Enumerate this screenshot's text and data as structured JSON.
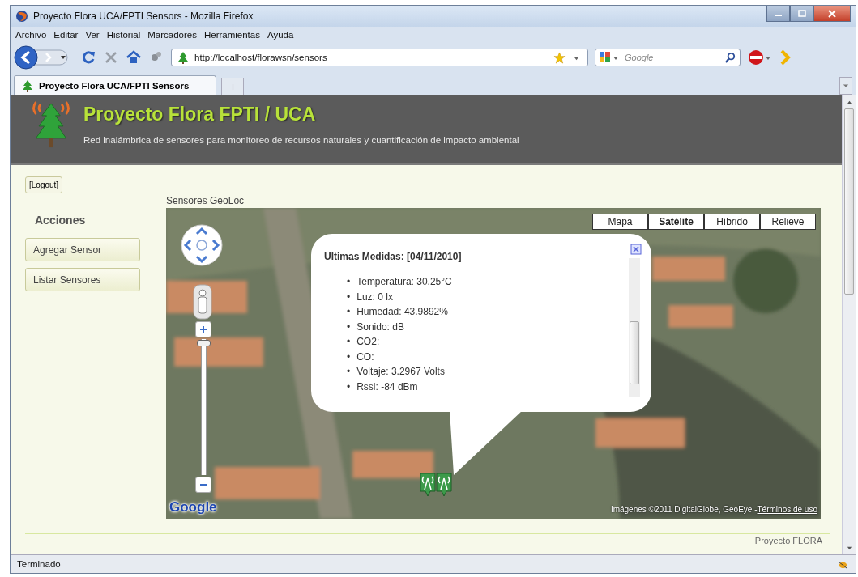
{
  "window": {
    "title": "Proyecto Flora UCA/FPTI Sensors - Mozilla Firefox"
  },
  "menu": [
    "Archivo",
    "Editar",
    "Ver",
    "Historial",
    "Marcadores",
    "Herramientas",
    "Ayuda"
  ],
  "toolbar": {
    "url": "http://localhost/florawsn/sensors",
    "search_placeholder": "Google"
  },
  "tabs": [
    {
      "label": "Proyecto Flora UCA/FPTI Sensors",
      "selected": true
    }
  ],
  "header": {
    "title": "Proyecto Flora FPTI / UCA",
    "subtitle": "Red inalámbrica de sensores para monitoreo de recursos naturales y cuantificación de impacto ambiental"
  },
  "sidebar": {
    "logout": "[Logout]",
    "heading": "Acciones",
    "buttons": [
      "Agregar Sensor",
      "Listar Sensores"
    ]
  },
  "map": {
    "label": "Sensores GeoLoc",
    "map_types": [
      {
        "label": "Mapa",
        "selected": false
      },
      {
        "label": "Satélite",
        "selected": true
      },
      {
        "label": "Híbrido",
        "selected": false
      },
      {
        "label": "Relieve",
        "selected": false
      }
    ],
    "zoom": {
      "level": 0.98
    },
    "info_window": {
      "title": "Ultimas Medidas: [04/11/2010]",
      "bullet": "•",
      "items": [
        "Temperatura: 30.25°C",
        "Luz: 0 lx",
        "Humedad: 43.9892%",
        "Sonido: dB",
        "CO2:",
        "CO:",
        "Voltaje: 3.2967 Volts",
        "Rssi: -84 dBm"
      ]
    },
    "logo": "Google",
    "attribution": "Imágenes ©2011 DigitalGlobe, GeoEye - ",
    "terms_link": "Términos de uso"
  },
  "footer": "Proyecto FLORA",
  "status_bar": "Terminado"
}
